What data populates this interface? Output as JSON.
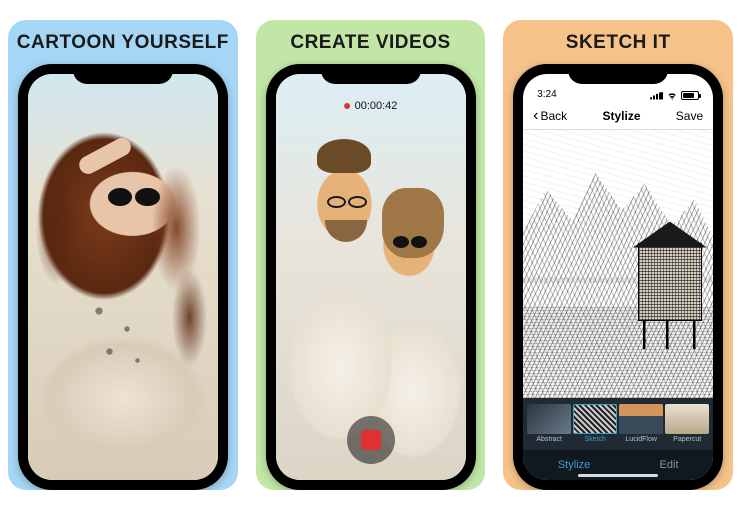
{
  "cards": [
    {
      "title": "CARTOON YOURSELF",
      "bg": "#a6d6f5"
    },
    {
      "title": "CREATE VIDEOS",
      "bg": "#c2e6a6"
    },
    {
      "title": "SKETCH IT",
      "bg": "#f5c38a"
    }
  ],
  "video": {
    "timer": "00:00:42"
  },
  "stylize": {
    "status_time": "3:24",
    "nav_back": "Back",
    "nav_title": "Stylize",
    "nav_save": "Save",
    "filters": [
      {
        "label": "Abstract",
        "selected": false
      },
      {
        "label": "Sketch",
        "selected": true
      },
      {
        "label": "LucidFlow",
        "selected": false
      },
      {
        "label": "Papercut",
        "selected": false
      }
    ],
    "tabs": [
      {
        "label": "Stylize",
        "active": true
      },
      {
        "label": "Edit",
        "active": false
      }
    ]
  }
}
